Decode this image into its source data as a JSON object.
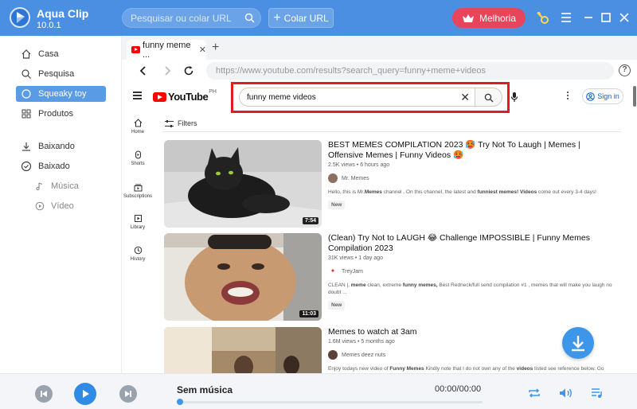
{
  "app": {
    "name": "Aqua Clip",
    "version": "10.0.1"
  },
  "header": {
    "search_placeholder": "Pesquisar ou colar URL",
    "paste_url_label": "Colar URL",
    "upgrade_label": "Melhoria"
  },
  "sidebar": {
    "items": [
      {
        "label": "Casa",
        "icon": "home-icon"
      },
      {
        "label": "Pesquisa",
        "icon": "search-icon"
      },
      {
        "label": "Squeaky toy",
        "icon": "circle-icon",
        "active": true
      },
      {
        "label": "Produtos",
        "icon": "grid-icon"
      },
      {
        "label": "Baixando",
        "icon": "download-icon"
      },
      {
        "label": "Baixado",
        "icon": "check-circle-icon"
      }
    ],
    "sub_items": [
      {
        "label": "Música",
        "icon": "music-note-icon"
      },
      {
        "label": "Vídeo",
        "icon": "play-circle-icon"
      }
    ]
  },
  "browser": {
    "tab_title": "funny meme ...",
    "url": "https://www.youtube.com/results?search_query=funny+meme+videos"
  },
  "youtube": {
    "region": "PH",
    "search_value": "funny meme videos",
    "sign_in": "Sign in",
    "filters": "Filters",
    "guide": [
      "Home",
      "Shorts",
      "Subscriptions",
      "Library",
      "History"
    ],
    "videos": [
      {
        "title": "BEST MEMES COMPILATION 2023 🥵 Try Not To Laugh | Memes | Offensive Memes | Funny Videos 🥵",
        "meta": "2.5K views • 6 hours ago",
        "channel": "Mr. Memes",
        "description_pre": "Hello, this is Mr.",
        "description_bold1": "Memes",
        "description_mid": " channel . On this channel, the latest and ",
        "description_bold2": "funniest memes! Videos",
        "description_post": " come out every 3-4 days!",
        "badge": "New",
        "duration": "7:54"
      },
      {
        "title": "(Clean) Try Not to LAUGH 😂 Challenge IMPOSSIBLE | Funny Memes Compilation 2023",
        "meta": "31K views • 1 day ago",
        "channel": "TreyJam",
        "description_pre": "CLEAN |, ",
        "description_bold1": "meme",
        "description_mid": " clean, extreme ",
        "description_bold2": "funny memes,",
        "description_post": " Best Redneck/full send compilation #1 , memes that will make you laugh no doubt ...",
        "badge": "New",
        "duration": "11:03"
      },
      {
        "title": "Memes to watch at 3am",
        "meta": "1.6M views • 5 months ago",
        "channel": "Memes deez nuts",
        "description_pre": "Enjoy todays new video of ",
        "description_bold1": "Funny Memes",
        "description_mid": " Kindly note that I do not own any of the ",
        "description_bold2": "videos",
        "description_post": " listed see reference below. Go send",
        "badge": "",
        "duration": ""
      }
    ]
  },
  "player": {
    "now_playing": "Sem música",
    "time": "00:00/00:00"
  },
  "colors": {
    "titlebar": "#4a8fe2",
    "accent": "#3d96e9",
    "upgrade": "#e8455a",
    "highlight_box": "#e01b24"
  }
}
